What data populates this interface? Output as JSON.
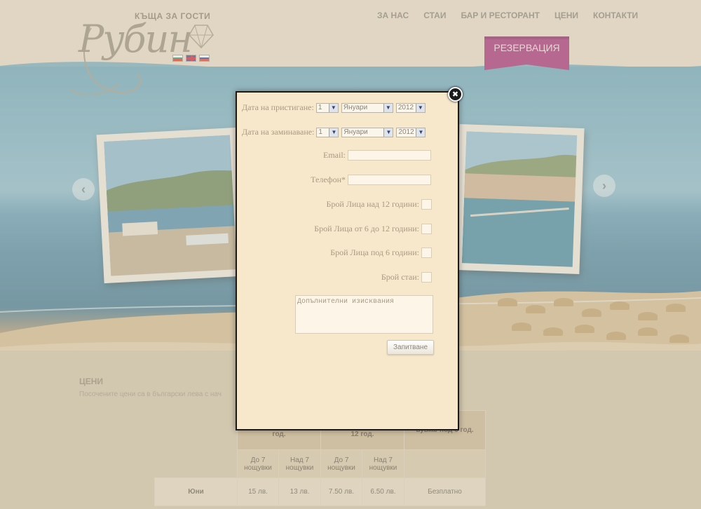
{
  "header": {
    "logo_top": "КЪЩА ЗА ГОСТИ",
    "logo_script": "Рубин",
    "nav": [
      "ЗА НАС",
      "СТАИ",
      "БАР И РЕСТОРАНТ",
      "ЦЕНИ",
      "КОНТАКТИ"
    ],
    "reserve_label": "РЕЗЕРВАЦИЯ",
    "accent_color": "#9c1c6e"
  },
  "hero": {
    "prev_icon": "chevron-left-icon",
    "next_icon": "chevron-right-icon",
    "prev_glyph": "‹",
    "next_glyph": "›"
  },
  "content": {
    "title": "ЦЕНИ",
    "subtitle": "Посочените цени са в български лева с нач",
    "table": {
      "col_headers": [
        "легло на лица над 12 год.",
        "легло на лица от 6 до 12 год.",
        "вувка/ под 6 год."
      ],
      "sub_headers": [
        "До 7 нощувки",
        "Над 7 нощувки",
        "До 7 нощувки",
        "Над 7 нощувки"
      ],
      "rows": [
        {
          "month": "Юни",
          "values": [
            "15 лв.",
            "13 лв.",
            "7.50 лв.",
            "6.50 лв.",
            "Безплатно"
          ]
        }
      ]
    }
  },
  "modal": {
    "close_glyph": "✖",
    "arrival_label": "Дата на пристигане:",
    "departure_label": "Дата на заминаване:",
    "day_value": "1",
    "month_value": "Януари",
    "year_value": "2012",
    "email_label": "Email:",
    "phone_label": "Телефон*",
    "adults_label": "Брой Лица над 12 години:",
    "kids_6_12_label": "Брой Лица от 6 до 12 години:",
    "kids_under6_label": "Брой Лица под 6 години:",
    "rooms_label": "Брой стаи:",
    "requirements_placeholder": "Допълнителни изисквания",
    "submit_label": "Запитване"
  }
}
